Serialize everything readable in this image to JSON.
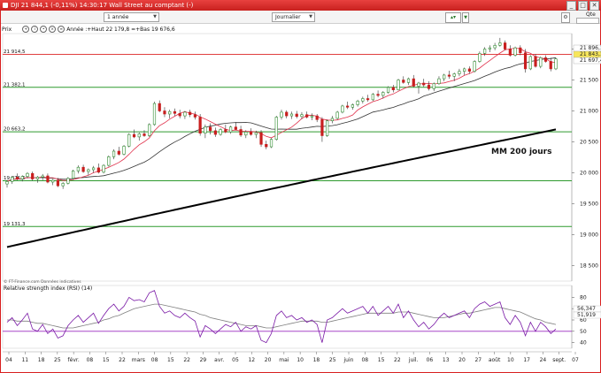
{
  "window": {
    "title": "DJI  21 844,1  (-0,11%)  14:30:17  Wall Street au comptant (-)",
    "buttons": [
      "_",
      "□",
      "✕"
    ]
  },
  "toolbar": {
    "period": "1 année",
    "interval": "Journalier",
    "qte_label": "Qte"
  },
  "legend": {
    "label": "Prix",
    "text": "Année :+Haut 22 179,8 =+Bas 19 676,6"
  },
  "colors": {
    "up": "#2e8b2e",
    "down": "#c81e1e",
    "ma_short": "#e0304a",
    "ma_mid": "#333333",
    "ma_long": "#000000",
    "hline_green": "#2e9a2e",
    "hline_red": "#e04040",
    "rsi": "#7a1aa6",
    "rsi_ma": "#808080"
  },
  "chart_data": [
    {
      "type": "candlestick",
      "title": "",
      "annotation": "MM 200 jours",
      "source_note": "© FT-Finance.com Données indicatives",
      "ylim": [
        18250,
        22250
      ],
      "y_ticks": [
        18500,
        19000,
        19500,
        20000,
        20500,
        21000,
        21500,
        22000
      ],
      "y_tick_labels": [
        "18 500",
        "19 000",
        "19 500",
        "20 000",
        "20 500",
        "21 000",
        "21 500",
        "22 000"
      ],
      "right_values": [
        "21 896,1",
        "21 843,1",
        "21 697,4"
      ],
      "hlines": [
        {
          "value": 21914.5,
          "label": "21 914,5",
          "color": "red"
        },
        {
          "value": 21382.1,
          "label": "21 382,1",
          "color": "green"
        },
        {
          "value": 20663.2,
          "label": "20 663,2",
          "color": "green"
        },
        {
          "value": 19871.6,
          "label": "19 871,6",
          "color": "green"
        },
        {
          "value": 19131.3,
          "label": "19 131,3",
          "color": "green"
        }
      ],
      "x_tick_labels": [
        "04",
        "11",
        "18",
        "25",
        "févr.",
        "08",
        "15",
        "22",
        "mars",
        "08",
        "15",
        "22",
        "29",
        "avr.",
        "05",
        "12",
        "20",
        "mai",
        "10",
        "18",
        "25",
        "juin",
        "08",
        "15",
        "22",
        "juil.",
        "06",
        "13",
        "20",
        "27",
        "août",
        "10",
        "17",
        "24",
        "sept.",
        "07"
      ],
      "candles": [
        [
          19820,
          19880,
          19760,
          19860
        ],
        [
          19860,
          19950,
          19820,
          19930
        ],
        [
          19930,
          19990,
          19880,
          19900
        ],
        [
          19900,
          19960,
          19860,
          19940
        ],
        [
          19940,
          20010,
          19910,
          19990
        ],
        [
          19990,
          20020,
          19870,
          19900
        ],
        [
          19900,
          19950,
          19840,
          19930
        ],
        [
          19930,
          19980,
          19880,
          19950
        ],
        [
          19950,
          19990,
          19830,
          19850
        ],
        [
          19850,
          19900,
          19800,
          19880
        ],
        [
          19880,
          19920,
          19770,
          19790
        ],
        [
          19790,
          19850,
          19740,
          19830
        ],
        [
          19830,
          19930,
          19810,
          19910
        ],
        [
          19910,
          20050,
          19890,
          20030
        ],
        [
          20030,
          20120,
          19990,
          20090
        ],
        [
          20090,
          20130,
          20000,
          20020
        ],
        [
          20020,
          20070,
          19960,
          20050
        ],
        [
          20050,
          20110,
          20000,
          20080
        ],
        [
          20080,
          20150,
          19990,
          20010
        ],
        [
          20010,
          20140,
          19990,
          20120
        ],
        [
          20120,
          20280,
          20100,
          20260
        ],
        [
          20260,
          20380,
          20220,
          20350
        ],
        [
          20350,
          20420,
          20280,
          20300
        ],
        [
          20300,
          20450,
          20280,
          20430
        ],
        [
          20430,
          20640,
          20410,
          20620
        ],
        [
          20620,
          20700,
          20560,
          20580
        ],
        [
          20580,
          20650,
          20520,
          20630
        ],
        [
          20630,
          20690,
          20580,
          20600
        ],
        [
          20600,
          20800,
          20580,
          20780
        ],
        [
          20780,
          21150,
          20760,
          21120
        ],
        [
          21120,
          21170,
          20980,
          21000
        ],
        [
          21000,
          21060,
          20900,
          20950
        ],
        [
          20950,
          21020,
          20880,
          20990
        ],
        [
          20990,
          21040,
          20920,
          20960
        ],
        [
          20960,
          21020,
          20880,
          20920
        ],
        [
          20920,
          21000,
          20870,
          20980
        ],
        [
          20980,
          21020,
          20900,
          20940
        ],
        [
          20940,
          20990,
          20860,
          20900
        ],
        [
          20900,
          20950,
          20600,
          20640
        ],
        [
          20640,
          20780,
          20560,
          20740
        ],
        [
          20740,
          20800,
          20620,
          20680
        ],
        [
          20680,
          20730,
          20580,
          20620
        ],
        [
          20620,
          20720,
          20600,
          20700
        ],
        [
          20700,
          20780,
          20640,
          20660
        ],
        [
          20660,
          20760,
          20630,
          20740
        ],
        [
          20740,
          20820,
          20690,
          20700
        ],
        [
          20700,
          20760,
          20580,
          20610
        ],
        [
          20610,
          20690,
          20560,
          20660
        ],
        [
          20660,
          20720,
          20600,
          20620
        ],
        [
          20620,
          20680,
          20560,
          20650
        ],
        [
          20650,
          20690,
          20420,
          20460
        ],
        [
          20460,
          20520,
          20380,
          20420
        ],
        [
          20420,
          20560,
          20400,
          20540
        ],
        [
          20540,
          20920,
          20520,
          20900
        ],
        [
          20900,
          21020,
          20860,
          20980
        ],
        [
          20980,
          21010,
          20880,
          20920
        ],
        [
          20920,
          20990,
          20870,
          20950
        ],
        [
          20950,
          21000,
          20880,
          20910
        ],
        [
          20910,
          20980,
          20870,
          20940
        ],
        [
          20940,
          20990,
          20880,
          20900
        ],
        [
          20900,
          20960,
          20850,
          20920
        ],
        [
          20920,
          20950,
          20820,
          20860
        ],
        [
          20860,
          20900,
          20500,
          20600
        ],
        [
          20600,
          20860,
          20580,
          20840
        ],
        [
          20840,
          20920,
          20800,
          20880
        ],
        [
          20880,
          21000,
          20860,
          20980
        ],
        [
          20980,
          21100,
          20960,
          21080
        ],
        [
          21080,
          21150,
          21030,
          21060
        ],
        [
          21060,
          21120,
          21020,
          21100
        ],
        [
          21100,
          21180,
          21070,
          21160
        ],
        [
          21160,
          21230,
          21120,
          21200
        ],
        [
          21200,
          21260,
          21150,
          21180
        ],
        [
          21180,
          21290,
          21160,
          21270
        ],
        [
          21270,
          21330,
          21220,
          21250
        ],
        [
          21250,
          21320,
          21200,
          21300
        ],
        [
          21300,
          21400,
          21280,
          21380
        ],
        [
          21380,
          21420,
          21300,
          21340
        ],
        [
          21340,
          21520,
          21330,
          21500
        ],
        [
          21500,
          21560,
          21440,
          21460
        ],
        [
          21460,
          21540,
          21420,
          21520
        ],
        [
          21520,
          21580,
          21380,
          21400
        ],
        [
          21400,
          21470,
          21280,
          21450
        ],
        [
          21450,
          21520,
          21390,
          21420
        ],
        [
          21420,
          21480,
          21330,
          21360
        ],
        [
          21360,
          21460,
          21320,
          21440
        ],
        [
          21440,
          21560,
          21420,
          21520
        ],
        [
          21520,
          21600,
          21480,
          21580
        ],
        [
          21580,
          21650,
          21520,
          21560
        ],
        [
          21560,
          21620,
          21480,
          21600
        ],
        [
          21600,
          21680,
          21560,
          21640
        ],
        [
          21640,
          21700,
          21580,
          21680
        ],
        [
          21680,
          21720,
          21600,
          21640
        ],
        [
          21640,
          21820,
          21620,
          21800
        ],
        [
          21800,
          21960,
          21780,
          21930
        ],
        [
          21930,
          22030,
          21890,
          22000
        ],
        [
          22000,
          22060,
          21950,
          22020
        ],
        [
          22020,
          22100,
          21980,
          22060
        ],
        [
          22060,
          22180,
          22040,
          22100
        ],
        [
          22100,
          22140,
          21980,
          22000
        ],
        [
          22000,
          22060,
          21880,
          21900
        ],
        [
          21900,
          22040,
          21880,
          22020
        ],
        [
          22020,
          22060,
          21900,
          21940
        ],
        [
          21940,
          22000,
          21620,
          21680
        ],
        [
          21680,
          21900,
          21660,
          21880
        ],
        [
          21880,
          21920,
          21700,
          21720
        ],
        [
          21720,
          21880,
          21690,
          21860
        ],
        [
          21860,
          21900,
          21780,
          21800
        ],
        [
          21800,
          21860,
          21640,
          21680
        ],
        [
          21680,
          21860,
          21660,
          21840
        ]
      ]
    },
    {
      "type": "line",
      "title": "Relative strength index (RSI) (14)",
      "ylim": [
        35,
        85
      ],
      "y_ticks": [
        40,
        50,
        60,
        70,
        80
      ],
      "y_tick_labels": [
        "40",
        "50",
        "60",
        "70",
        "80"
      ],
      "hlines": [
        {
          "value": 50,
          "color": "purple"
        }
      ],
      "right_values": [
        "56,347",
        "51,919"
      ],
      "series": [
        {
          "values": [
            58,
            62,
            55,
            60,
            66,
            52,
            50,
            56,
            48,
            52,
            44,
            46,
            55,
            60,
            64,
            58,
            62,
            66,
            57,
            64,
            70,
            74,
            68,
            72,
            80,
            77,
            78,
            76,
            84,
            86,
            72,
            66,
            68,
            64,
            62,
            66,
            62,
            59,
            45,
            55,
            52,
            48,
            52,
            56,
            54,
            58,
            50,
            54,
            52,
            55,
            42,
            40,
            48,
            64,
            68,
            62,
            64,
            60,
            62,
            58,
            60,
            56,
            40,
            60,
            62,
            66,
            70,
            66,
            68,
            70,
            72,
            66,
            72,
            64,
            68,
            72,
            66,
            74,
            62,
            68,
            60,
            54,
            58,
            52,
            56,
            62,
            66,
            62,
            64,
            66,
            68,
            62,
            70,
            74,
            76,
            72,
            74,
            76,
            62,
            56,
            64,
            58,
            46,
            58,
            50,
            58,
            54,
            48,
            52
          ]
        },
        {
          "values": [
            60,
            60,
            59,
            59,
            59,
            58,
            57,
            57,
            56,
            55,
            54,
            53,
            53,
            53,
            54,
            55,
            56,
            57,
            58,
            60,
            61,
            63,
            64,
            66,
            68,
            70,
            71,
            72,
            73,
            74,
            74,
            73,
            72,
            71,
            70,
            69,
            68,
            67,
            65,
            64,
            62,
            61,
            60,
            59,
            58,
            57,
            56,
            55,
            55,
            55,
            54,
            53,
            53,
            54,
            55,
            56,
            57,
            58,
            59,
            59,
            59,
            59,
            58,
            58,
            59,
            60,
            61,
            62,
            63,
            64,
            65,
            66,
            66,
            66,
            66,
            66,
            66,
            67,
            67,
            67,
            66,
            65,
            64,
            63,
            62,
            62,
            62,
            63,
            64,
            65,
            66,
            66,
            67,
            68,
            69,
            70,
            71,
            71,
            70,
            69,
            68,
            67,
            65,
            63,
            61,
            60,
            58,
            57,
            56
          ]
        }
      ]
    }
  ]
}
